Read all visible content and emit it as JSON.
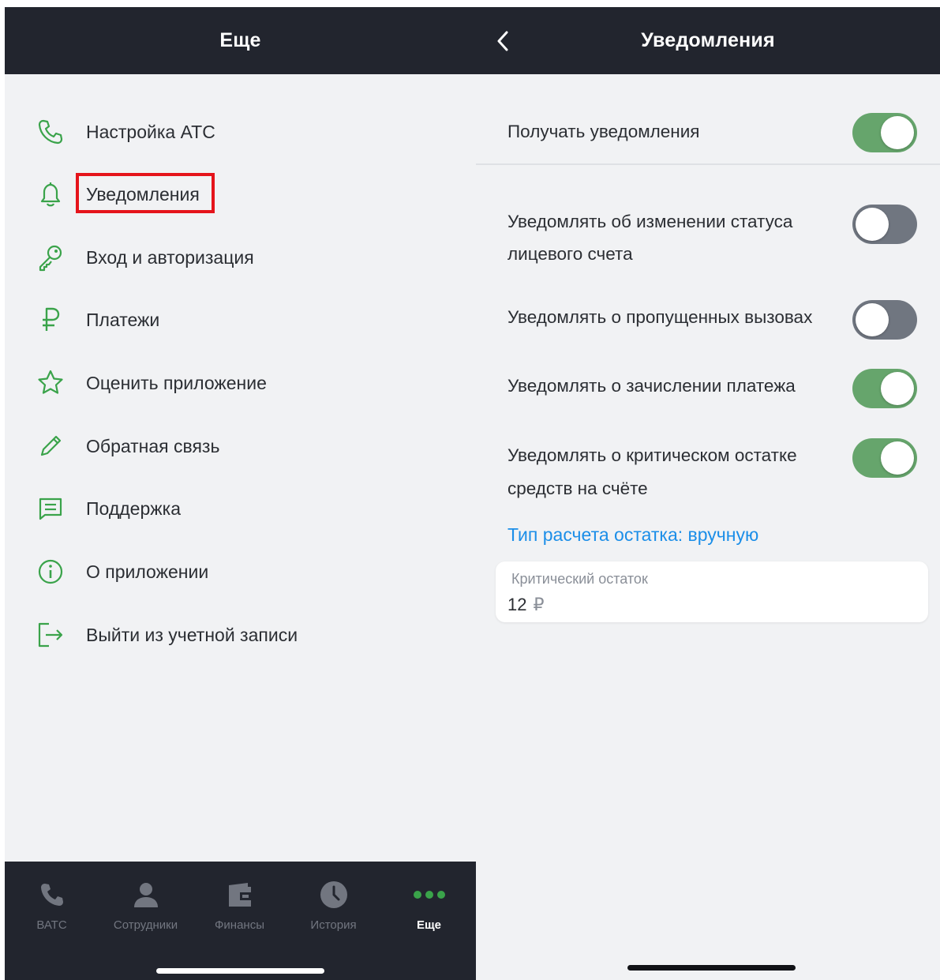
{
  "left": {
    "title": "Еще",
    "menu": [
      {
        "label": "Настройка АТС",
        "icon": "phone-icon"
      },
      {
        "label": "Уведомления",
        "icon": "bell-icon"
      },
      {
        "label": "Вход и авторизация",
        "icon": "key-icon"
      },
      {
        "label": "Платежи",
        "icon": "ruble-icon"
      },
      {
        "label": "Оценить приложение",
        "icon": "star-icon"
      },
      {
        "label": "Обратная связь",
        "icon": "pencil-icon"
      },
      {
        "label": "Поддержка",
        "icon": "chat-icon"
      },
      {
        "label": "О приложении",
        "icon": "info-icon"
      },
      {
        "label": "Выйти из учетной записи",
        "icon": "logout-icon"
      }
    ],
    "tabs": [
      {
        "label": "ВАТС",
        "icon": "phone-icon"
      },
      {
        "label": "Сотрудники",
        "icon": "person-icon"
      },
      {
        "label": "Финансы",
        "icon": "wallet-icon"
      },
      {
        "label": "История",
        "icon": "clock-icon"
      },
      {
        "label": "Еще",
        "icon": "more-dots-icon",
        "active": true
      }
    ]
  },
  "right": {
    "title": "Уведомления",
    "receive": {
      "label": "Получать уведомления",
      "on": true
    },
    "settings": [
      {
        "line1": "Уведомлять об изменении статуса",
        "line2": "лицевого счета",
        "on": false
      },
      {
        "line1": "Уведомлять о пропущенных вызовах",
        "line2": "",
        "on": false
      },
      {
        "line1": "Уведомлять о зачислении платежа",
        "line2": "",
        "on": true
      },
      {
        "line1": "Уведомлять о критическом остатке",
        "line2": "средств на счёте",
        "on": true
      }
    ],
    "calc_link": "Тип расчета остатка: вручную",
    "critical": {
      "label": "Критический остаток",
      "value": "12",
      "currency": "₽"
    }
  },
  "colors": {
    "accent_green": "#66a56c",
    "icon_green": "#3aa34a",
    "link_blue": "#1b8ee8",
    "highlight_red": "#e5141b",
    "dark_bar": "#22252e",
    "background": "#f1f2f4"
  }
}
